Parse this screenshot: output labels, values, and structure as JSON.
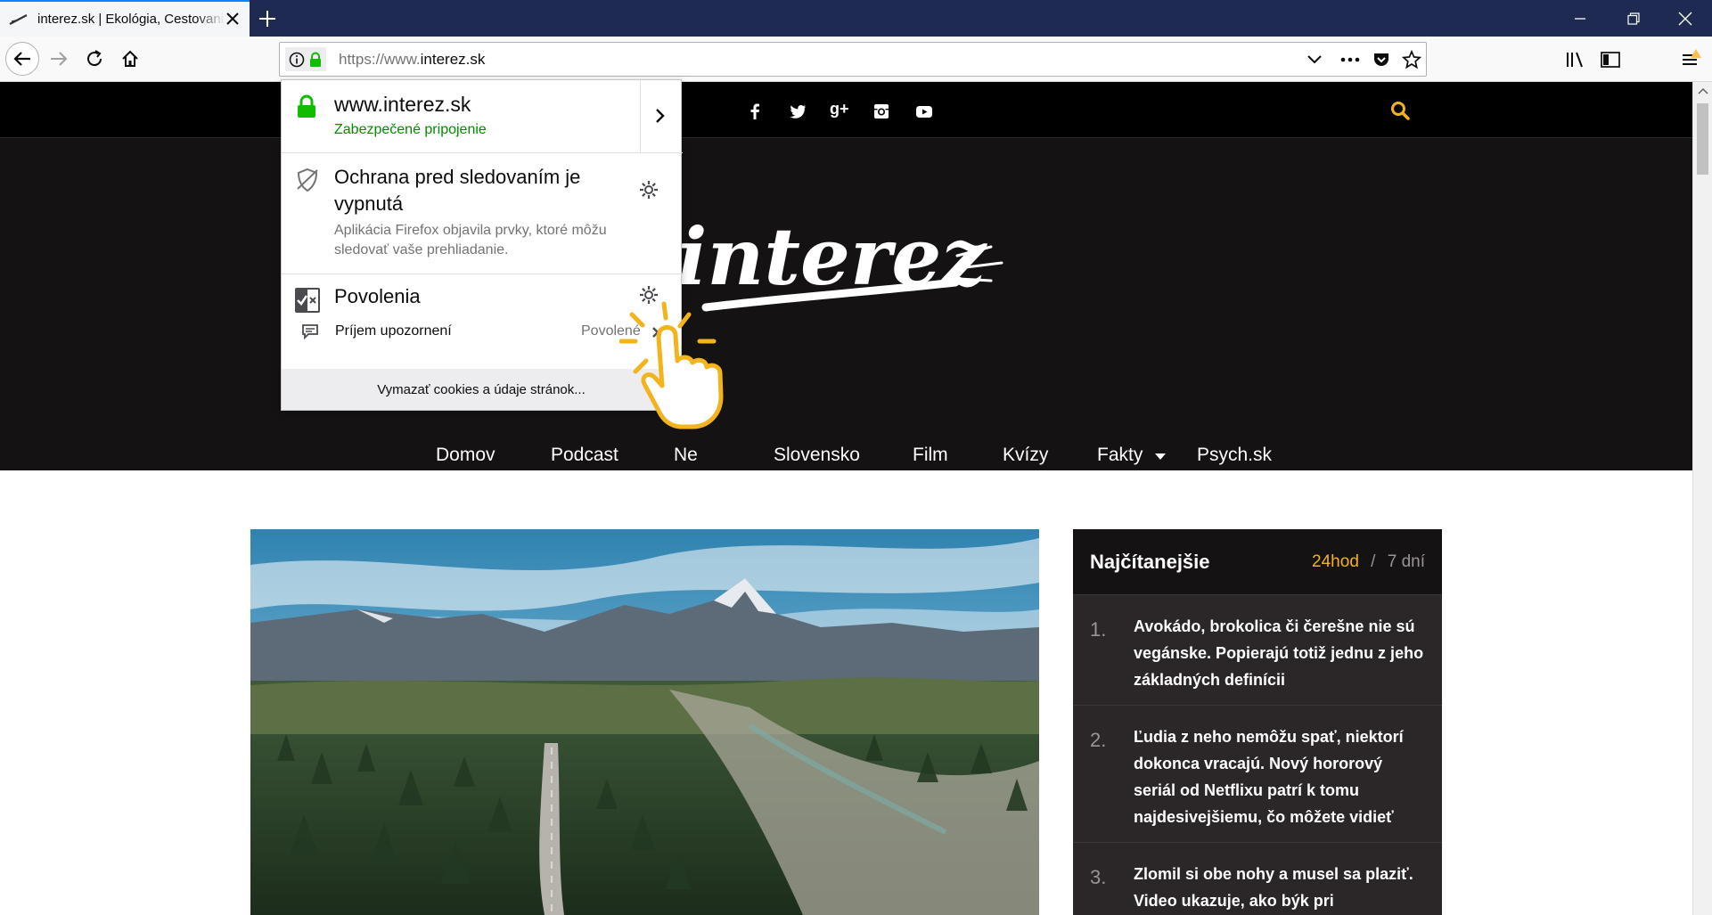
{
  "browser": {
    "tab_title": "interez.sk | Ekológia, Cestovanie",
    "url_prefix": "https://www.",
    "url_domain": "interez.sk"
  },
  "site": {
    "logo": "interez",
    "nav": [
      {
        "label": "Domov"
      },
      {
        "label": "Podcast"
      },
      {
        "label": "Ne"
      },
      {
        "label": "Slovensko"
      },
      {
        "label": "Film"
      },
      {
        "label": "Kvízy"
      },
      {
        "label": "Fakty"
      },
      {
        "label": "Psych.sk"
      }
    ],
    "social_icons": [
      "facebook-icon",
      "twitter-icon",
      "google-plus-icon",
      "instagram-icon",
      "youtube-icon"
    ],
    "accent": "#f2b31c"
  },
  "sidebar": {
    "title": "Najčítanejšie",
    "tab_24h": "24hod",
    "sep": "/",
    "tab_7d": "7 dní",
    "items": [
      {
        "num": "1.",
        "text": "Avokádo, brokolica či čerešne nie sú vegánske. Popierajú totiž jednu z jeho základných definícii"
      },
      {
        "num": "2.",
        "text": "Ľudia z neho nemôžu spať, niektorí dokonca vracajú. Nový hororový seriál od Netflixu patrí k tomu najdesivejšiemu, čo môžete vidieť"
      },
      {
        "num": "3.",
        "text": "Zlomil si obe nohy a musel sa plaziť. Video ukazuje, ako býk pri"
      }
    ]
  },
  "popup": {
    "host": "www.interez.sk",
    "secure": "Zabezpečené pripojenie",
    "tracking_title_1": "Ochrana pred sledovaním je",
    "tracking_title_2": "vypnutá",
    "tracking_desc": "Aplikácia Firefox objavila prvky, ktoré môžu sledovať vaše prehliadanie.",
    "permissions_title": "Povolenia",
    "permission_name": "Príjem upozornení",
    "permission_state": "Povolené",
    "footer": "Vymazať cookies a údaje stránok..."
  }
}
